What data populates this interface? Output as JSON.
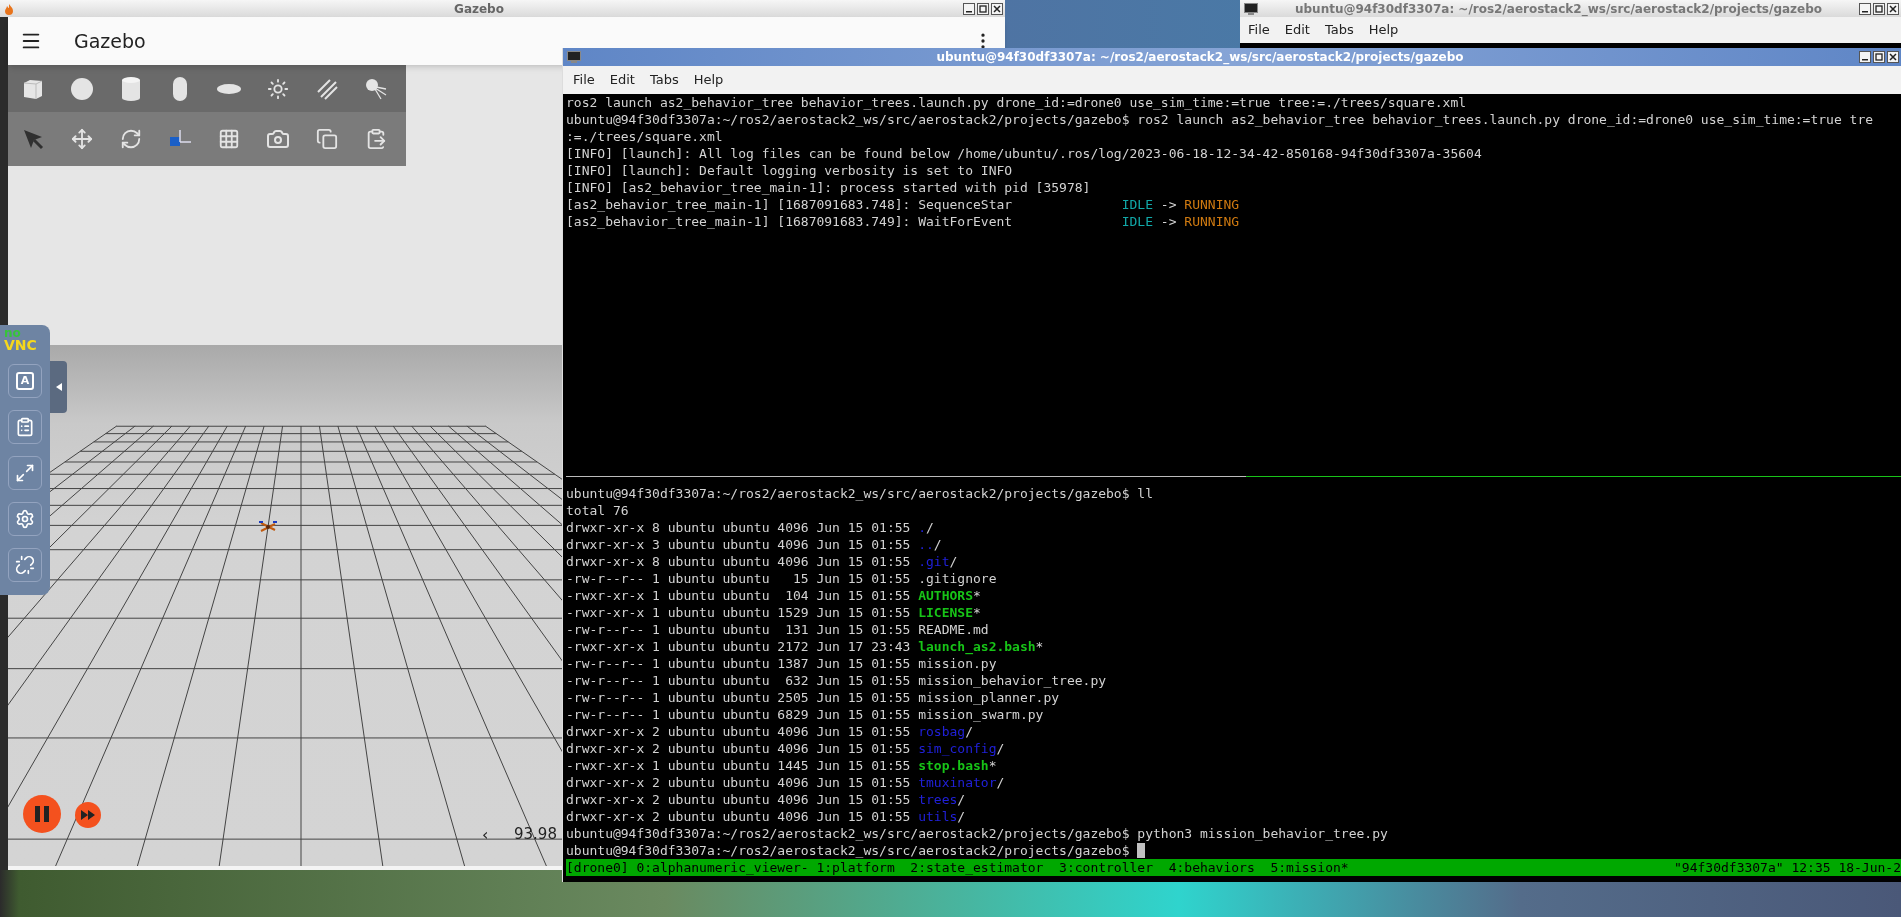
{
  "gazebo": {
    "window_title": "Gazebo",
    "app_title": "Gazebo",
    "rtf_prev": "‹",
    "rtf": "93.98"
  },
  "novnc": {
    "logo_top": "no",
    "logo_bottom": "VNC",
    "keyboard_key": "A"
  },
  "back_terminal": {
    "title": "ubuntu@94f30df3307a: ~/ros2/aerostack2_ws/src/aerostack2/projects/gazebo",
    "menu": [
      "File",
      "Edit",
      "Tabs",
      "Help"
    ]
  },
  "terminal": {
    "title": "ubuntu@94f30df3307a: ~/ros2/aerostack2_ws/src/aerostack2/projects/gazebo",
    "menu": [
      "File",
      "Edit",
      "Tabs",
      "Help"
    ],
    "panes": [
      {
        "cursor": false,
        "lines": [
          {
            "segments": [
              {
                "text": "ros2 launch as2_behavior_tree behavior_trees.launch.py drone_id:=drone0 use_sim_time:=true tree:=./trees/square.xml",
                "kind": "plain"
              }
            ]
          },
          {
            "segments": [
              {
                "text": "ubuntu@94f30df3307a:~/ros2/aerostack2_ws/src/aerostack2/projects/gazebo$ ros2 launch as2_behavior_tree behavior_trees.launch.py drone_id:=drone0 use_sim_time:=true tre",
                "kind": "plain"
              }
            ]
          },
          {
            "segments": [
              {
                "text": ":=./trees/square.xml",
                "kind": "plain"
              }
            ]
          },
          {
            "segments": [
              {
                "text": "[INFO] [launch]: All log files can be found below /home/ubuntu/.ros/log/2023-06-18-12-34-42-850168-94f30df3307a-35604",
                "kind": "plain"
              }
            ]
          },
          {
            "segments": [
              {
                "text": "[INFO] [launch]: Default logging verbosity is set to INFO",
                "kind": "plain"
              }
            ]
          },
          {
            "segments": [
              {
                "text": "[INFO] [as2_behavior_tree_main-1]: process started with pid [35978]",
                "kind": "plain"
              }
            ]
          },
          {
            "segments": [
              {
                "text": "[as2_behavior_tree_main-1] [1687091683.748]: SequenceStar              ",
                "kind": "plain"
              },
              {
                "text": "IDLE",
                "kind": "idle"
              },
              {
                "text": " -> ",
                "kind": "plain"
              },
              {
                "text": "RUNNING",
                "kind": "running"
              }
            ]
          },
          {
            "segments": [
              {
                "text": "[as2_behavior_tree_main-1] [1687091683.749]: WaitForEvent              ",
                "kind": "plain"
              },
              {
                "text": "IDLE",
                "kind": "idle"
              },
              {
                "text": " -> ",
                "kind": "plain"
              },
              {
                "text": "RUNNING",
                "kind": "running"
              }
            ]
          }
        ]
      },
      {
        "cursor": true,
        "lines": [
          {
            "segments": [
              {
                "text": "ubuntu@94f30df3307a:~/ros2/aerostack2_ws/src/aerostack2/projects/gazebo$ ll",
                "kind": "plain"
              }
            ]
          },
          {
            "segments": [
              {
                "text": "total 76",
                "kind": "plain"
              }
            ]
          },
          {
            "segments": [
              {
                "text": "drwxr-xr-x 8 ubuntu ubuntu 4096 Jun 15 01:55 ",
                "kind": "plain"
              },
              {
                "text": ".",
                "kind": "dir"
              },
              {
                "text": "/",
                "kind": "plain"
              }
            ]
          },
          {
            "segments": [
              {
                "text": "drwxr-xr-x 3 ubuntu ubuntu 4096 Jun 15 01:55 ",
                "kind": "plain"
              },
              {
                "text": "..",
                "kind": "dir"
              },
              {
                "text": "/",
                "kind": "plain"
              }
            ]
          },
          {
            "segments": [
              {
                "text": "drwxr-xr-x 8 ubuntu ubuntu 4096 Jun 15 01:55 ",
                "kind": "plain"
              },
              {
                "text": ".git",
                "kind": "dir"
              },
              {
                "text": "/",
                "kind": "plain"
              }
            ]
          },
          {
            "segments": [
              {
                "text": "-rw-r--r-- 1 ubuntu ubuntu   15 Jun 15 01:55 .gitignore",
                "kind": "plain"
              }
            ]
          },
          {
            "segments": [
              {
                "text": "-rwxr-xr-x 1 ubuntu ubuntu  104 Jun 15 01:55 ",
                "kind": "plain"
              },
              {
                "text": "AUTHORS",
                "kind": "exec"
              },
              {
                "text": "*",
                "kind": "plain"
              }
            ]
          },
          {
            "segments": [
              {
                "text": "-rwxr-xr-x 1 ubuntu ubuntu 1529 Jun 15 01:55 ",
                "kind": "plain"
              },
              {
                "text": "LICENSE",
                "kind": "exec"
              },
              {
                "text": "*",
                "kind": "plain"
              }
            ]
          },
          {
            "segments": [
              {
                "text": "-rw-r--r-- 1 ubuntu ubuntu  131 Jun 15 01:55 README.md",
                "kind": "plain"
              }
            ]
          },
          {
            "segments": [
              {
                "text": "-rwxr-xr-x 1 ubuntu ubuntu 2172 Jun 17 23:43 ",
                "kind": "plain"
              },
              {
                "text": "launch_as2.bash",
                "kind": "exec"
              },
              {
                "text": "*",
                "kind": "plain"
              }
            ]
          },
          {
            "segments": [
              {
                "text": "-rw-r--r-- 1 ubuntu ubuntu 1387 Jun 15 01:55 mission.py",
                "kind": "plain"
              }
            ]
          },
          {
            "segments": [
              {
                "text": "-rw-r--r-- 1 ubuntu ubuntu  632 Jun 15 01:55 mission_behavior_tree.py",
                "kind": "plain"
              }
            ]
          },
          {
            "segments": [
              {
                "text": "-rw-r--r-- 1 ubuntu ubuntu 2505 Jun 15 01:55 mission_planner.py",
                "kind": "plain"
              }
            ]
          },
          {
            "segments": [
              {
                "text": "-rw-r--r-- 1 ubuntu ubuntu 6829 Jun 15 01:55 mission_swarm.py",
                "kind": "plain"
              }
            ]
          },
          {
            "segments": [
              {
                "text": "drwxr-xr-x 2 ubuntu ubuntu 4096 Jun 15 01:55 ",
                "kind": "plain"
              },
              {
                "text": "rosbag",
                "kind": "dir"
              },
              {
                "text": "/",
                "kind": "plain"
              }
            ]
          },
          {
            "segments": [
              {
                "text": "drwxr-xr-x 2 ubuntu ubuntu 4096 Jun 15 01:55 ",
                "kind": "plain"
              },
              {
                "text": "sim_config",
                "kind": "dir"
              },
              {
                "text": "/",
                "kind": "plain"
              }
            ]
          },
          {
            "segments": [
              {
                "text": "-rwxr-xr-x 1 ubuntu ubuntu 1445 Jun 15 01:55 ",
                "kind": "plain"
              },
              {
                "text": "stop.bash",
                "kind": "exec"
              },
              {
                "text": "*",
                "kind": "plain"
              }
            ]
          },
          {
            "segments": [
              {
                "text": "drwxr-xr-x 2 ubuntu ubuntu 4096 Jun 15 01:55 ",
                "kind": "plain"
              },
              {
                "text": "tmuxinator",
                "kind": "dir"
              },
              {
                "text": "/",
                "kind": "plain"
              }
            ]
          },
          {
            "segments": [
              {
                "text": "drwxr-xr-x 2 ubuntu ubuntu 4096 Jun 15 01:55 ",
                "kind": "plain"
              },
              {
                "text": "trees",
                "kind": "dir"
              },
              {
                "text": "/",
                "kind": "plain"
              }
            ]
          },
          {
            "segments": [
              {
                "text": "drwxr-xr-x 2 ubuntu ubuntu 4096 Jun 15 01:55 ",
                "kind": "plain"
              },
              {
                "text": "utils",
                "kind": "dir"
              },
              {
                "text": "/",
                "kind": "plain"
              }
            ]
          },
          {
            "segments": [
              {
                "text": "ubuntu@94f30df3307a:~/ros2/aerostack2_ws/src/aerostack2/projects/gazebo$ python3 mission_behavior_tree.py",
                "kind": "plain"
              }
            ]
          },
          {
            "segments": [
              {
                "text": "ubuntu@94f30df3307a:~/ros2/aerostack2_ws/src/aerostack2/projects/gazebo$ ",
                "kind": "plain"
              }
            ]
          }
        ]
      }
    ],
    "status_bar": {
      "left": "[drone0] 0:alphanumeric_viewer- 1:platform  2:state_estimator  3:controller  4:behaviors  5:mission*",
      "right": "\"94f30df3307a\" 12:35 18-Jun-2"
    }
  }
}
